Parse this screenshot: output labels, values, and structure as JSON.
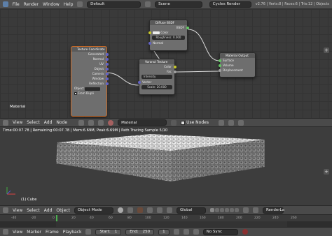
{
  "topbar": {
    "menus": [
      "File",
      "Render",
      "Window",
      "Help"
    ],
    "layout": "Default",
    "scene": "Scene",
    "engine": "Cycles Render",
    "info": "v2.76 | Verts:8 | Faces:6 | Tris:12 | Objects"
  },
  "nodes": {
    "texcoord": {
      "title": "Texture Coordinate",
      "outputs": [
        "Generated",
        "Normal",
        "UV",
        "Object",
        "Camera",
        "Window",
        "Reflection"
      ],
      "object_label": "Object",
      "from_dupli": "From Dupli"
    },
    "diffuse": {
      "title": "Diffuse BSDF",
      "output": "BSDF",
      "color": "Color",
      "roughness_label": "Roughness:",
      "roughness_value": "0.000",
      "normal": "Normal"
    },
    "voronoi": {
      "title": "Voronoi Texture",
      "outputs": [
        "Color",
        "Fac"
      ],
      "mode": "Intensity",
      "vector": "Vector",
      "scale_label": "Scale:",
      "scale_value": "20.000"
    },
    "output": {
      "title": "Material Output",
      "inputs": [
        "Surface",
        "Volume",
        "Displacement"
      ]
    },
    "material_label": "Material"
  },
  "nodeheader": {
    "items": [
      "View",
      "Select",
      "Add",
      "Node"
    ],
    "material": "Material",
    "use_nodes": "Use Nodes"
  },
  "viewport": {
    "status": "Time:00:07.78 | Remaining:00:07.78 | Mem:6.69M, Peak:6.69M | Path Tracing Sample 5/10",
    "object_label": "(1) Cube",
    "header_items": [
      "View",
      "Select",
      "Add",
      "Object"
    ],
    "mode": "Object Mode",
    "orientation": "Global",
    "render_layer": "RenderLa"
  },
  "timeline": {
    "ticks": [
      "-40",
      "-20",
      "0",
      "20",
      "40",
      "60",
      "80",
      "100",
      "120",
      "140",
      "160",
      "180",
      "200",
      "220",
      "240",
      "260"
    ],
    "items": [
      "View",
      "Marker",
      "Frame",
      "Playback"
    ],
    "start_label": "Start:",
    "start_value": "1",
    "end_label": "End:",
    "end_value": "250",
    "current": "1",
    "sync": "No Sync"
  }
}
